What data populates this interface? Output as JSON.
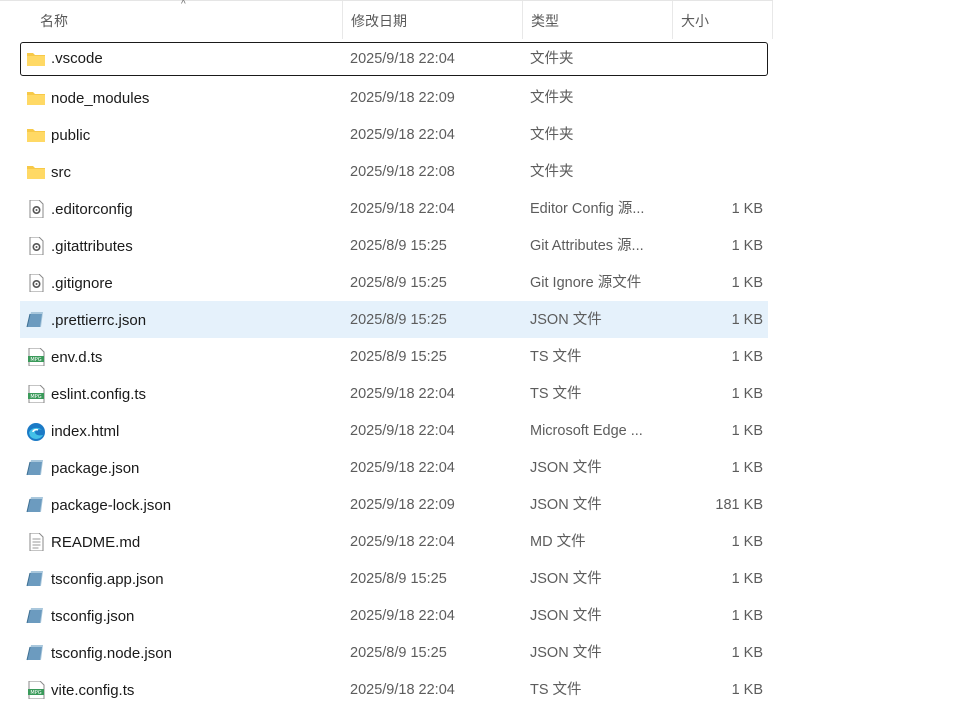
{
  "columns": {
    "name": "名称",
    "modified": "修改日期",
    "type": "类型",
    "size": "大小"
  },
  "sort_indicator": "^",
  "files": [
    {
      "name": ".vscode",
      "modified": "2025/9/18 22:04",
      "type": "文件夹",
      "size": "",
      "icon": "folder-icon"
    },
    {
      "name": "node_modules",
      "modified": "2025/9/18 22:09",
      "type": "文件夹",
      "size": "",
      "icon": "folder-icon"
    },
    {
      "name": "public",
      "modified": "2025/9/18 22:04",
      "type": "文件夹",
      "size": "",
      "icon": "folder-icon"
    },
    {
      "name": "src",
      "modified": "2025/9/18 22:08",
      "type": "文件夹",
      "size": "",
      "icon": "folder-icon"
    },
    {
      "name": ".editorconfig",
      "modified": "2025/9/18 22:04",
      "type": "Editor Config 源...",
      "size": "1 KB",
      "icon": "config-file-icon"
    },
    {
      "name": ".gitattributes",
      "modified": "2025/8/9 15:25",
      "type": "Git Attributes 源...",
      "size": "1 KB",
      "icon": "config-file-icon"
    },
    {
      "name": ".gitignore",
      "modified": "2025/8/9 15:25",
      "type": "Git Ignore 源文件",
      "size": "1 KB",
      "icon": "config-file-icon"
    },
    {
      "name": ".prettierrc.json",
      "modified": "2025/8/9 15:25",
      "type": "JSON 文件",
      "size": "1 KB",
      "icon": "json-file-icon"
    },
    {
      "name": "env.d.ts",
      "modified": "2025/8/9 15:25",
      "type": "TS 文件",
      "size": "1 KB",
      "icon": "ts-file-icon"
    },
    {
      "name": "eslint.config.ts",
      "modified": "2025/9/18 22:04",
      "type": "TS 文件",
      "size": "1 KB",
      "icon": "ts-file-icon"
    },
    {
      "name": "index.html",
      "modified": "2025/9/18 22:04",
      "type": "Microsoft Edge ...",
      "size": "1 KB",
      "icon": "edge-icon"
    },
    {
      "name": "package.json",
      "modified": "2025/9/18 22:04",
      "type": "JSON 文件",
      "size": "1 KB",
      "icon": "json-file-icon"
    },
    {
      "name": "package-lock.json",
      "modified": "2025/9/18 22:09",
      "type": "JSON 文件",
      "size": "181 KB",
      "icon": "json-file-icon"
    },
    {
      "name": "README.md",
      "modified": "2025/9/18 22:04",
      "type": "MD 文件",
      "size": "1 KB",
      "icon": "text-file-icon"
    },
    {
      "name": "tsconfig.app.json",
      "modified": "2025/8/9 15:25",
      "type": "JSON 文件",
      "size": "1 KB",
      "icon": "json-file-icon"
    },
    {
      "name": "tsconfig.json",
      "modified": "2025/9/18 22:04",
      "type": "JSON 文件",
      "size": "1 KB",
      "icon": "json-file-icon"
    },
    {
      "name": "tsconfig.node.json",
      "modified": "2025/8/9 15:25",
      "type": "JSON 文件",
      "size": "1 KB",
      "icon": "json-file-icon"
    },
    {
      "name": "vite.config.ts",
      "modified": "2025/9/18 22:04",
      "type": "TS 文件",
      "size": "1 KB",
      "icon": "ts-file-icon"
    }
  ],
  "focused_row": ".vscode",
  "selected_row": ".prettierrc.json",
  "colors": {
    "folder": "#f7c948",
    "selection": "#e5f1fb",
    "ts_badge": "#3a9a5a",
    "json_badge": "#6c9bbf"
  }
}
